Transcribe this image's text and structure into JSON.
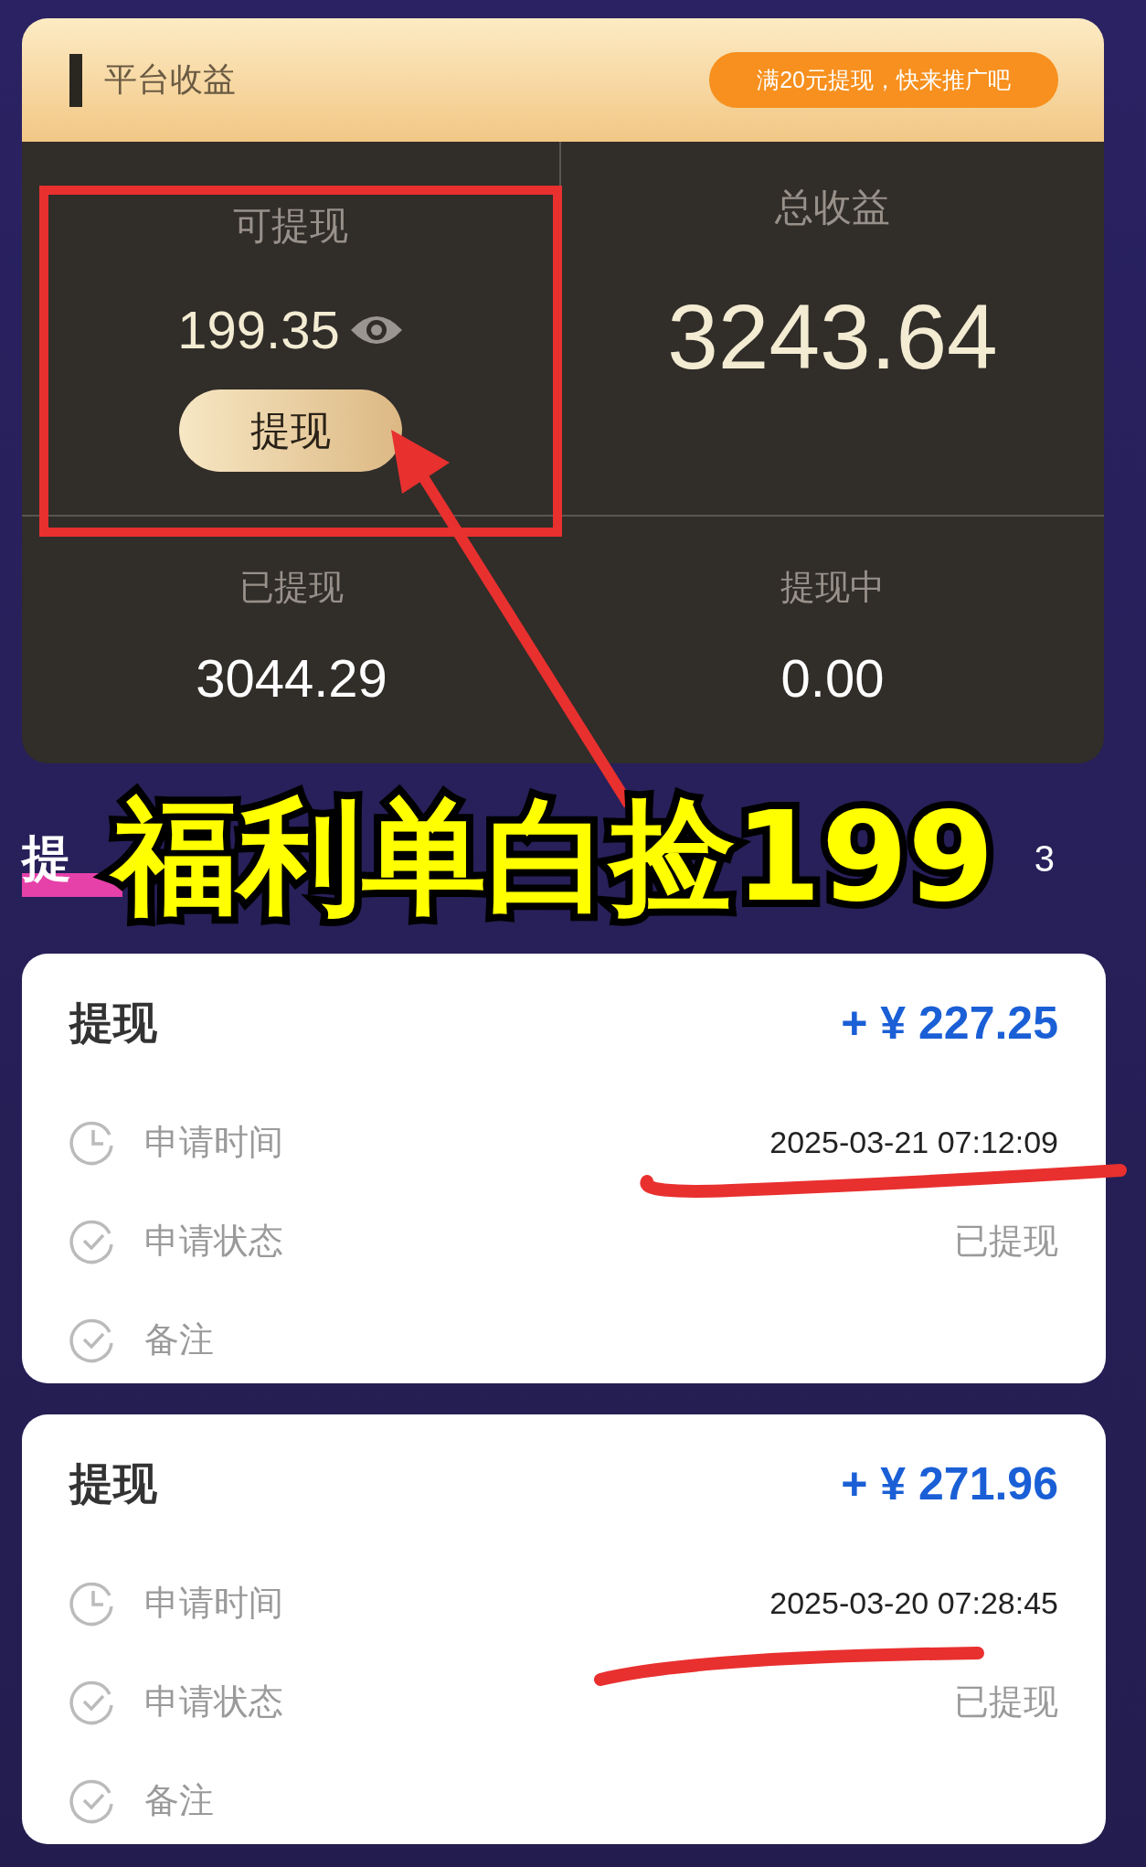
{
  "earnings_panel": {
    "title": "平台收益",
    "badge": "满20元提现，快来推广吧",
    "available": {
      "label": "可提现",
      "value": "199.35",
      "button": "提现"
    },
    "total": {
      "label": "总收益",
      "value": "3243.64"
    },
    "stats": [
      {
        "label": "已提现",
        "value": "3044.29"
      },
      {
        "label": "提现中",
        "value": "0.00"
      }
    ]
  },
  "section": {
    "title": "提",
    "right_text": "3"
  },
  "records": [
    {
      "title": "提现",
      "amount": "+ ¥ 227.25",
      "rows": [
        {
          "kind": "time",
          "label": "申请时间",
          "value": "2025-03-21 07:12:09"
        },
        {
          "kind": "status",
          "label": "申请状态",
          "value": "已提现"
        },
        {
          "kind": "note",
          "label": "备注"
        }
      ]
    },
    {
      "title": "提现",
      "amount": "+ ¥ 271.96",
      "rows": [
        {
          "kind": "time",
          "label": "申请时间",
          "value": "2025-03-20 07:28:45"
        },
        {
          "kind": "status",
          "label": "申请状态",
          "value": "已提现"
        },
        {
          "kind": "note",
          "label": "备注"
        }
      ]
    }
  ],
  "overlay_caption": "福利单白捡199"
}
